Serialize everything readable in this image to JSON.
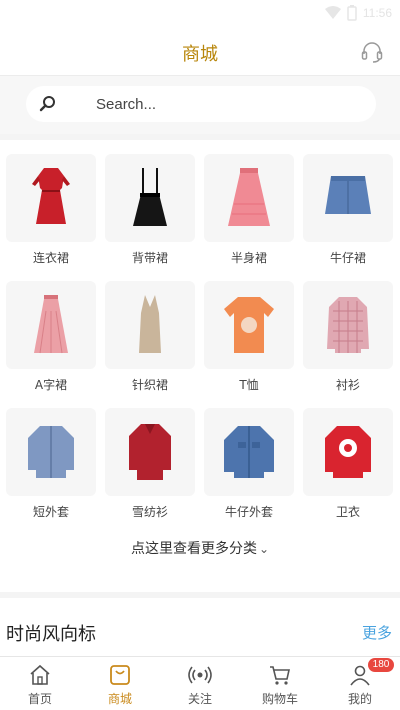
{
  "status_bar": {
    "time": "11:56"
  },
  "header": {
    "title": "商城"
  },
  "search": {
    "placeholder": "Search..."
  },
  "categories": [
    {
      "label": "连衣裙",
      "icon": "red-dress"
    },
    {
      "label": "背带裙",
      "icon": "black-pinafore-skirt"
    },
    {
      "label": "半身裙",
      "icon": "pink-tulle-skirt"
    },
    {
      "label": "牛仔裙",
      "icon": "denim-skirt"
    },
    {
      "label": "A字裙",
      "icon": "pink-pleated-skirt"
    },
    {
      "label": "针织裙",
      "icon": "knit-dress"
    },
    {
      "label": "T恤",
      "icon": "orange-tshirt"
    },
    {
      "label": "衬衫",
      "icon": "plaid-shirt"
    },
    {
      "label": "短外套",
      "icon": "blue-short-jacket"
    },
    {
      "label": "雪纺衫",
      "icon": "red-chiffon-blouse"
    },
    {
      "label": "牛仔外套",
      "icon": "denim-jacket"
    },
    {
      "label": "卫衣",
      "icon": "red-sweatshirt"
    }
  ],
  "more_categories": {
    "label": "点这里查看更多分类",
    "icon": "chevron-down-icon"
  },
  "fashion": {
    "title": "时尚风向标",
    "more_label": "更多"
  },
  "tabbar": {
    "items": [
      {
        "label": "首页",
        "icon": "home-icon",
        "active": false
      },
      {
        "label": "商城",
        "icon": "shop-icon",
        "active": true
      },
      {
        "label": "关注",
        "icon": "broadcast-icon",
        "active": false
      },
      {
        "label": "购物车",
        "icon": "cart-icon",
        "active": false
      },
      {
        "label": "我的",
        "icon": "user-icon",
        "active": false,
        "badge": "180"
      }
    ]
  },
  "colors": {
    "accent": "#c98a1c",
    "title": "#b8860b",
    "link": "#4aa3df",
    "badge": "#e8473f"
  }
}
